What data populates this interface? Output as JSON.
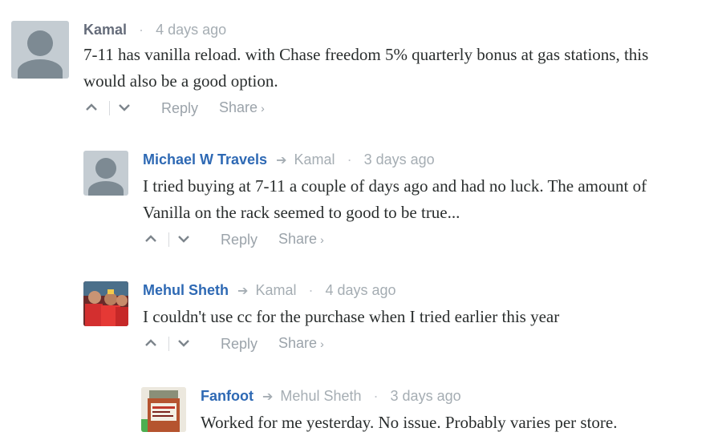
{
  "comments": [
    {
      "author": "Kamal",
      "parent": "",
      "time": "4 days ago",
      "text": "7-11 has vanilla reload. with Chase freedom 5% quarterly bonus at gas stations, this would also be a good option.",
      "reply_label": "Reply",
      "share_label": "Share",
      "avatar": "default-avatar-icon"
    },
    {
      "author": "Michael W Travels",
      "parent": "Kamal",
      "time": "3 days ago",
      "text": "I tried buying at 7-11 a couple of days ago and had no luck. The amount of Vanilla on the rack seemed to good to be true...",
      "reply_label": "Reply",
      "share_label": "Share",
      "avatar": "default-avatar-icon"
    },
    {
      "author": "Mehul Sheth",
      "parent": "Kamal",
      "time": "4 days ago",
      "text": "I couldn't use cc for the purchase when I tried earlier this year",
      "reply_label": "Reply",
      "share_label": "Share",
      "avatar": "user-photo"
    },
    {
      "author": "Fanfoot",
      "parent": "Mehul Sheth",
      "time": "3 days ago",
      "text": "Worked for me yesterday. No issue. Probably varies per store.",
      "avatar": "user-photo"
    }
  ],
  "colors": {
    "link_author": "#2e69b4",
    "muted": "#a5adb3",
    "text": "#2a2e2e"
  }
}
